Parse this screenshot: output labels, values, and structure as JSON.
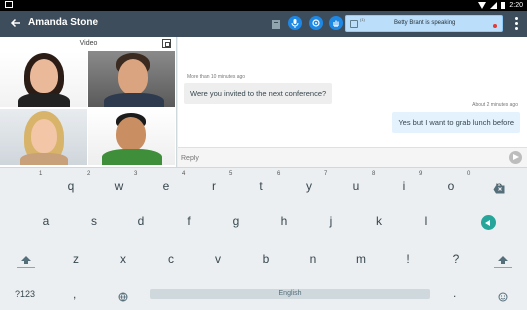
{
  "statusbar": {
    "time": "2:20"
  },
  "appbar": {
    "title": "Amanda Stone",
    "speaking_text": "Betty Brant is speaking",
    "speaking_number": "(1)"
  },
  "video": {
    "label": "Video"
  },
  "chat": {
    "messages": [
      {
        "meta": "More than 10 minutes ago",
        "text": "Were you invited to the next conference?"
      },
      {
        "meta": "About 2 minutes ago",
        "text": "Yes but I want to grab lunch before"
      }
    ]
  },
  "reply": {
    "placeholder": "Reply"
  },
  "keyboard": {
    "row1": [
      "q",
      "w",
      "e",
      "r",
      "t",
      "y",
      "u",
      "i",
      "o",
      "p"
    ],
    "row1_hints": [
      "1",
      "2",
      "3",
      "4",
      "5",
      "6",
      "7",
      "8",
      "9",
      "0"
    ],
    "row2": [
      "a",
      "s",
      "d",
      "f",
      "g",
      "h",
      "j",
      "k",
      "l"
    ],
    "row3": [
      "z",
      "x",
      "c",
      "v",
      "b",
      "n",
      "m",
      "!",
      "?"
    ],
    "symbols": "?123",
    "comma": ",",
    "space_label": "English",
    "period": "."
  },
  "colors": {
    "appbar": "#3e4d5c",
    "accent": "#1e88e5",
    "enter": "#26a69a",
    "speaking_bg": "#bbdefb"
  }
}
